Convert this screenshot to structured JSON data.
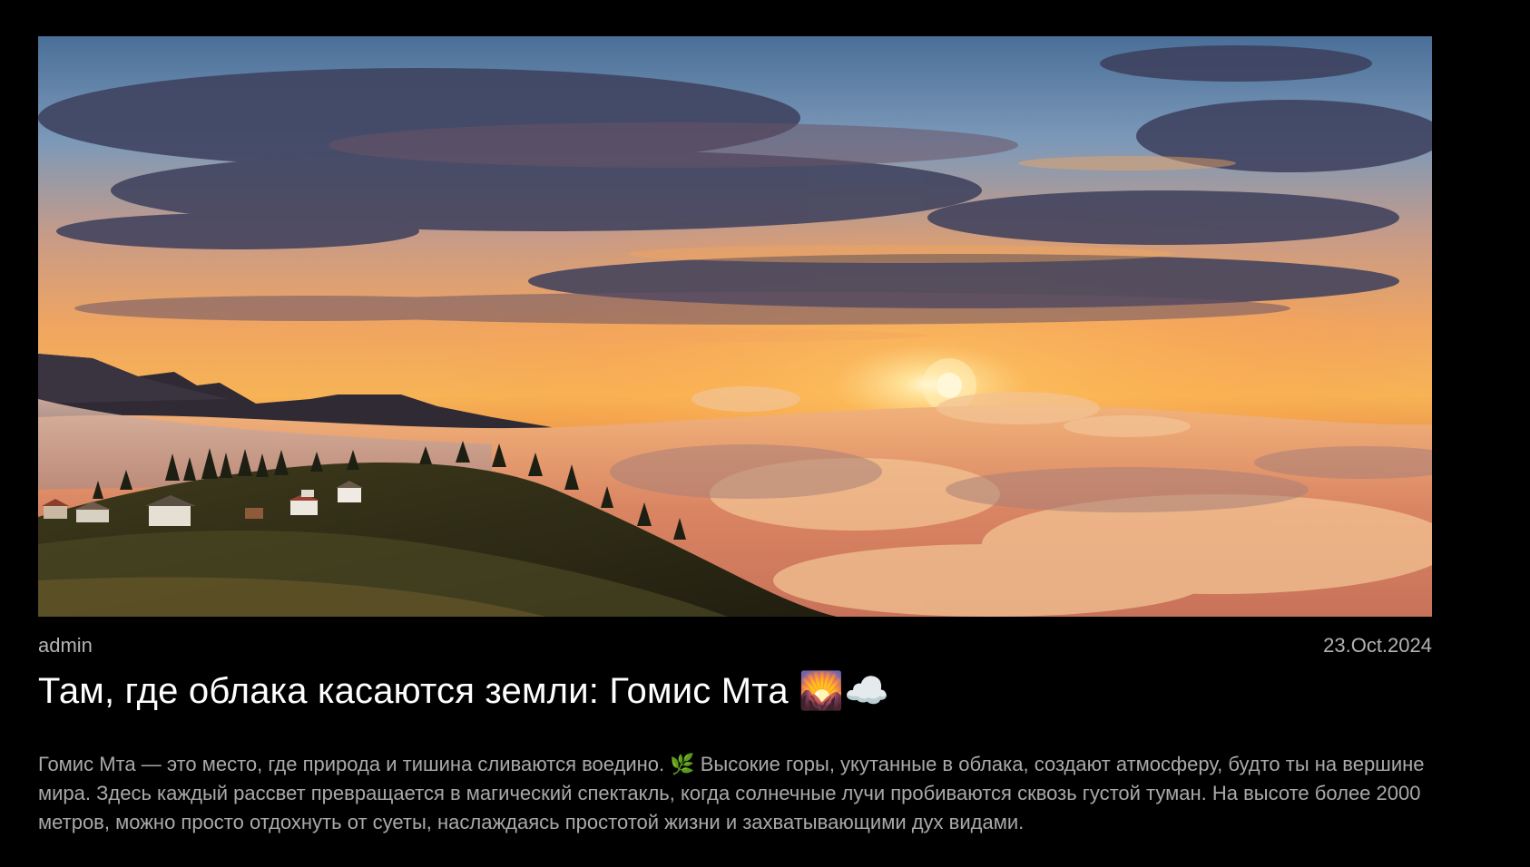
{
  "post": {
    "image_alt": "Закат над облаками в Гомис Мта",
    "author": "admin",
    "date": "23.Oct.2024",
    "title": "Там, где облака касаются земли: Гомис Мта 🌄☁️",
    "body": "Гомис Мта — это место, где природа и тишина сливаются воедино. 🌿 Высокие горы, укутанные в облака, создают атмосферу, будто ты на вершине мира. Здесь каждый рассвет превращается в магический спектакль, когда солнечные лучи пробиваются сквозь густой туман. На высоте более 2000 метров, можно просто отдохнуть от суеты, наслаждаясь простотой жизни и захватывающими дух видами."
  },
  "colors": {
    "background": "#000000",
    "title": "#ffffff",
    "meta": "#b3b3b3",
    "body": "#a9a9a9"
  }
}
